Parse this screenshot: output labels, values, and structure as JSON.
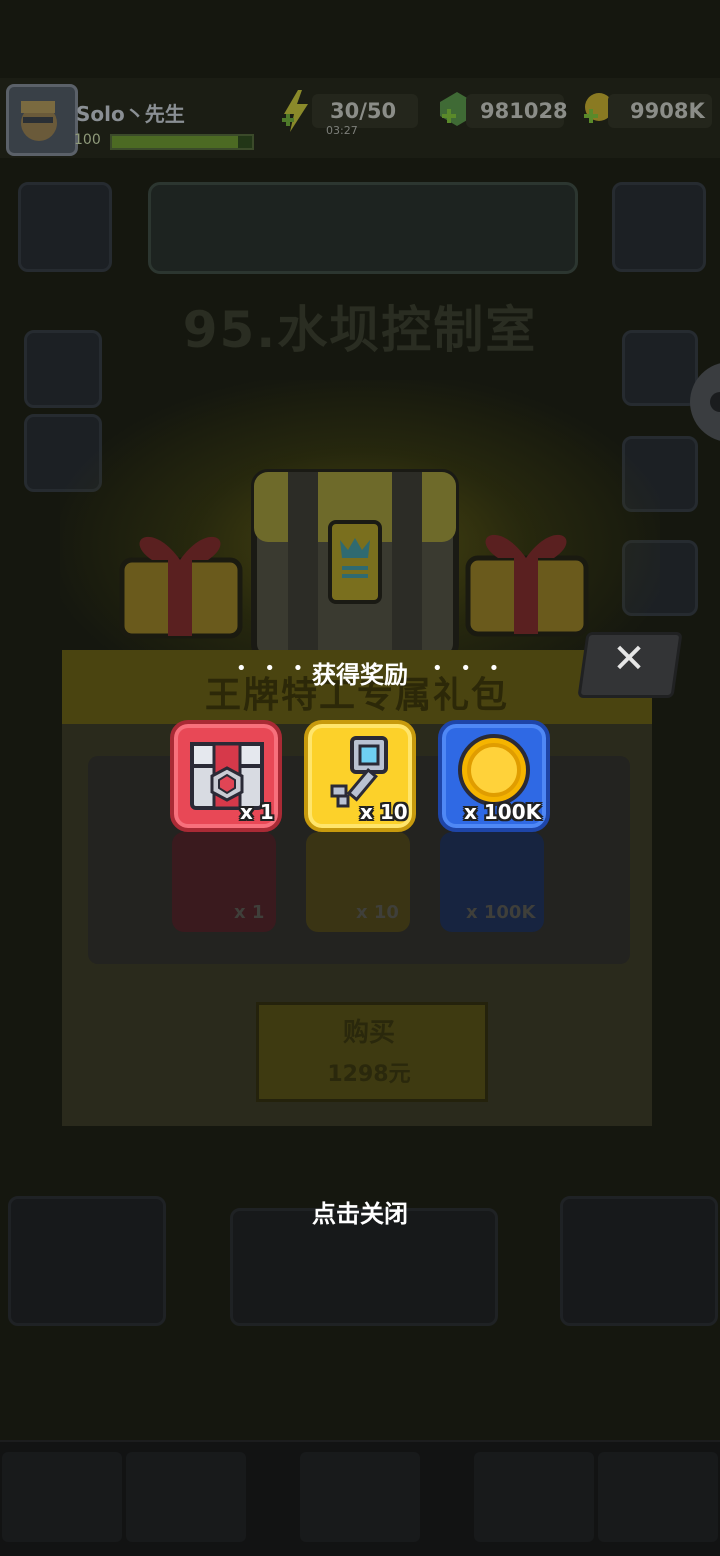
{
  "header": {
    "player_name": "Solo丶先生",
    "level": "100",
    "level_progress": 0.9,
    "energy": "30/50",
    "energy_timer": "03:27",
    "gems": "981028",
    "coins": "9908K"
  },
  "background": {
    "chapter_title": "95.水坝控制室",
    "pack_title": "王牌特工专属礼包",
    "buy_label": "购买",
    "buy_price": "1298元",
    "ghost_items": [
      {
        "qty": "x 1"
      },
      {
        "qty": "x 10"
      },
      {
        "qty": "x 100K"
      }
    ]
  },
  "popup": {
    "title": "获得奖励",
    "title_dots": "• • •",
    "rewards": [
      {
        "name": "red-chest",
        "qty": "x 1",
        "color": "#e84856"
      },
      {
        "name": "key",
        "qty": "x 10",
        "color": "#fcd12a"
      },
      {
        "name": "gold-coin",
        "qty": "x 100K",
        "color": "#2f69e4"
      }
    ],
    "close_hint": "点击关闭",
    "close_symbol": "✕"
  },
  "colors": {
    "accent_green": "#8fe02a",
    "gold": "#fcd12a"
  }
}
